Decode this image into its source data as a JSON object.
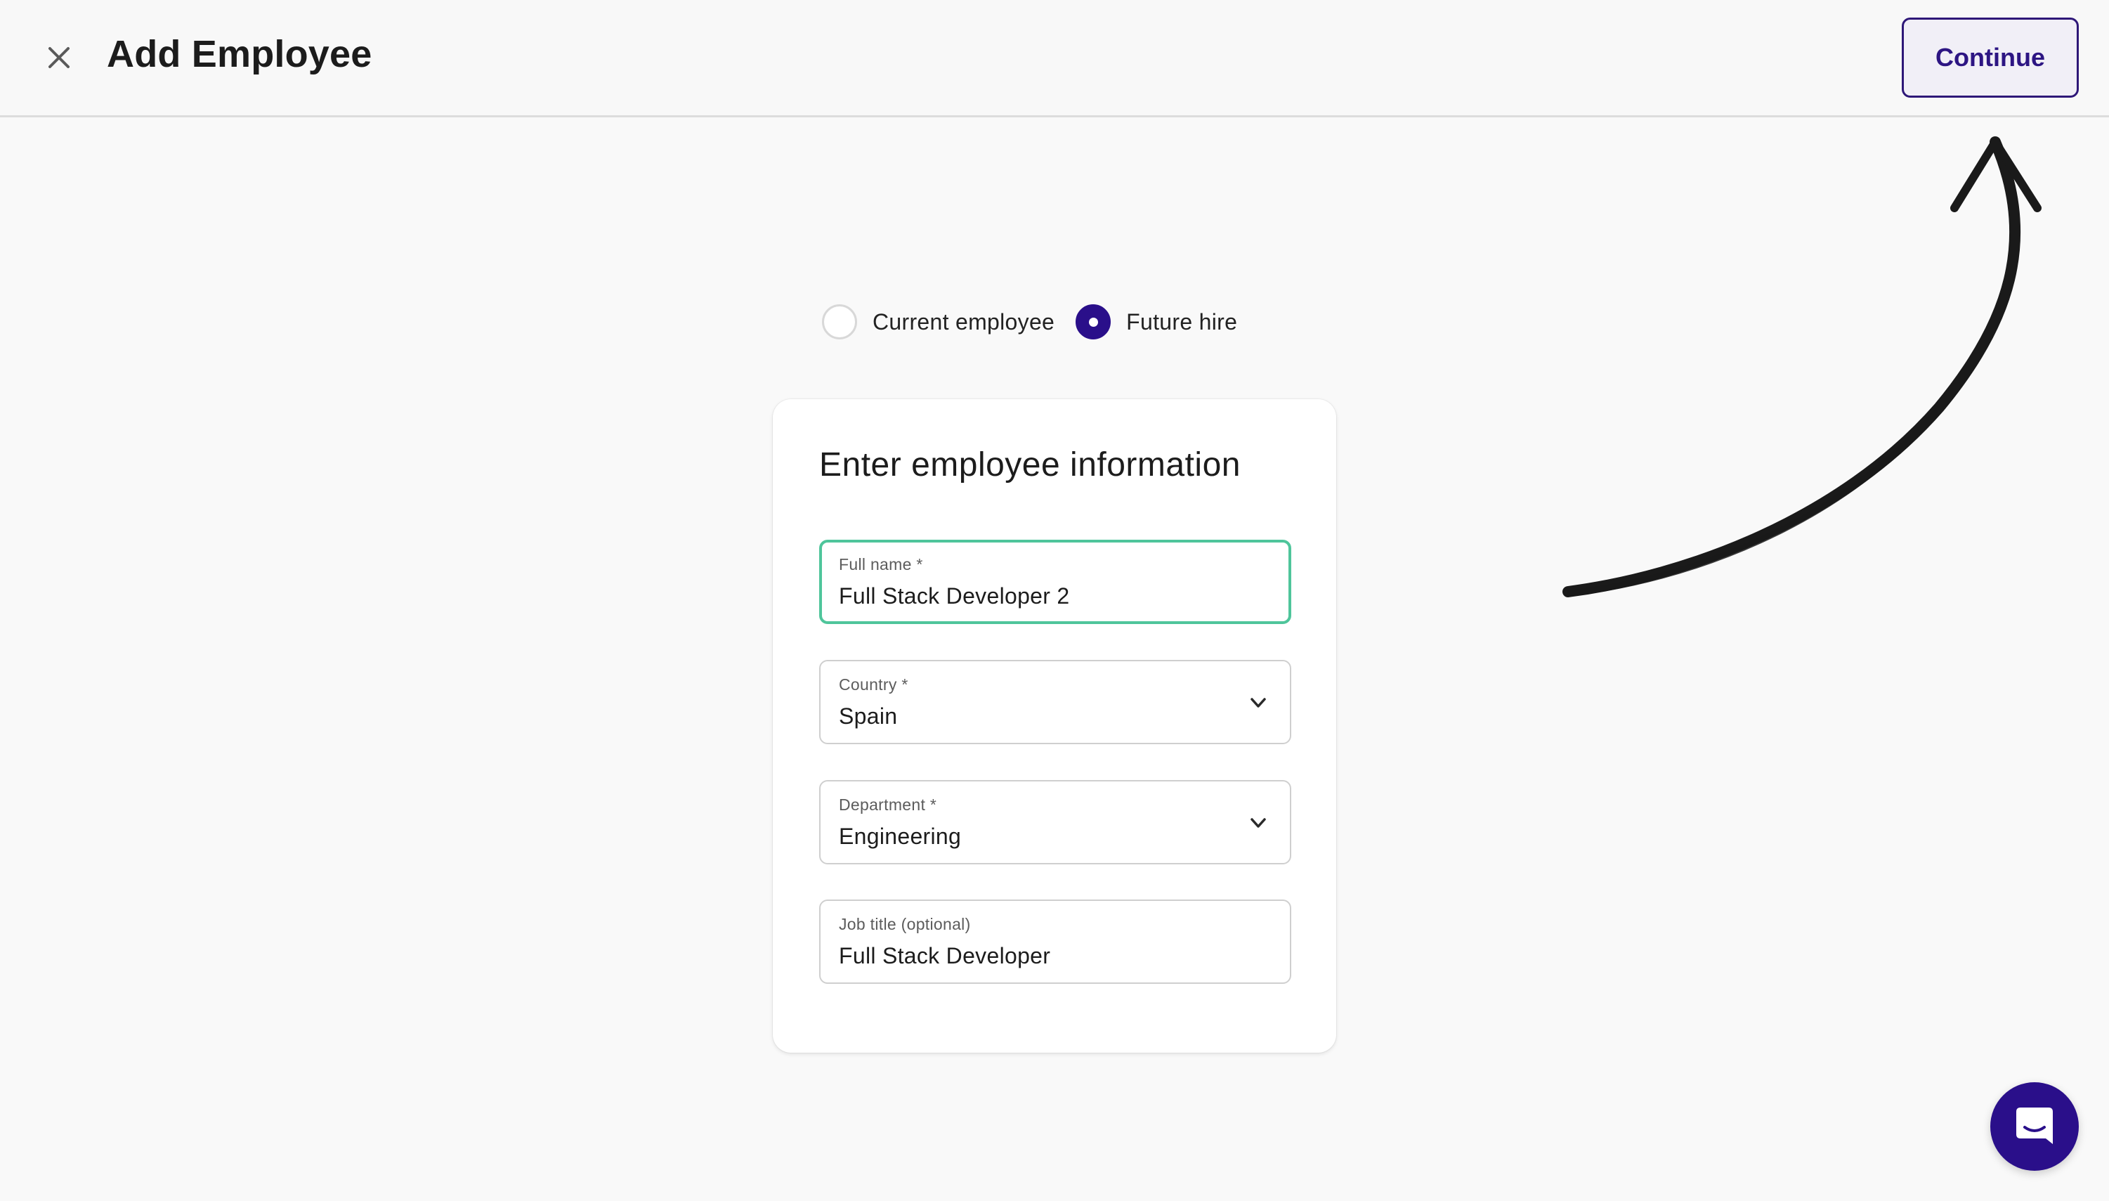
{
  "header": {
    "title": "Add Employee",
    "continue_label": "Continue"
  },
  "employee_type": {
    "options": [
      {
        "label": "Current employee",
        "selected": false
      },
      {
        "label": "Future hire",
        "selected": true
      }
    ]
  },
  "form": {
    "title": "Enter employee information",
    "fields": {
      "full_name": {
        "label": "Full name *",
        "value": "Full Stack Developer 2"
      },
      "country": {
        "label": "Country *",
        "value": "Spain"
      },
      "department": {
        "label": "Department *",
        "value": "Engineering"
      },
      "job_title": {
        "label": "Job title (optional)",
        "value": "Full Stack Developer"
      }
    }
  },
  "icons": {
    "close": "close-icon",
    "chevron": "chevron-down-icon",
    "chat": "chat-icon",
    "annotation": "hand-drawn-arrow-icon"
  },
  "colors": {
    "brand": "#2a0f8a",
    "focus": "#4fc59b",
    "background": "#f9f9f9"
  }
}
